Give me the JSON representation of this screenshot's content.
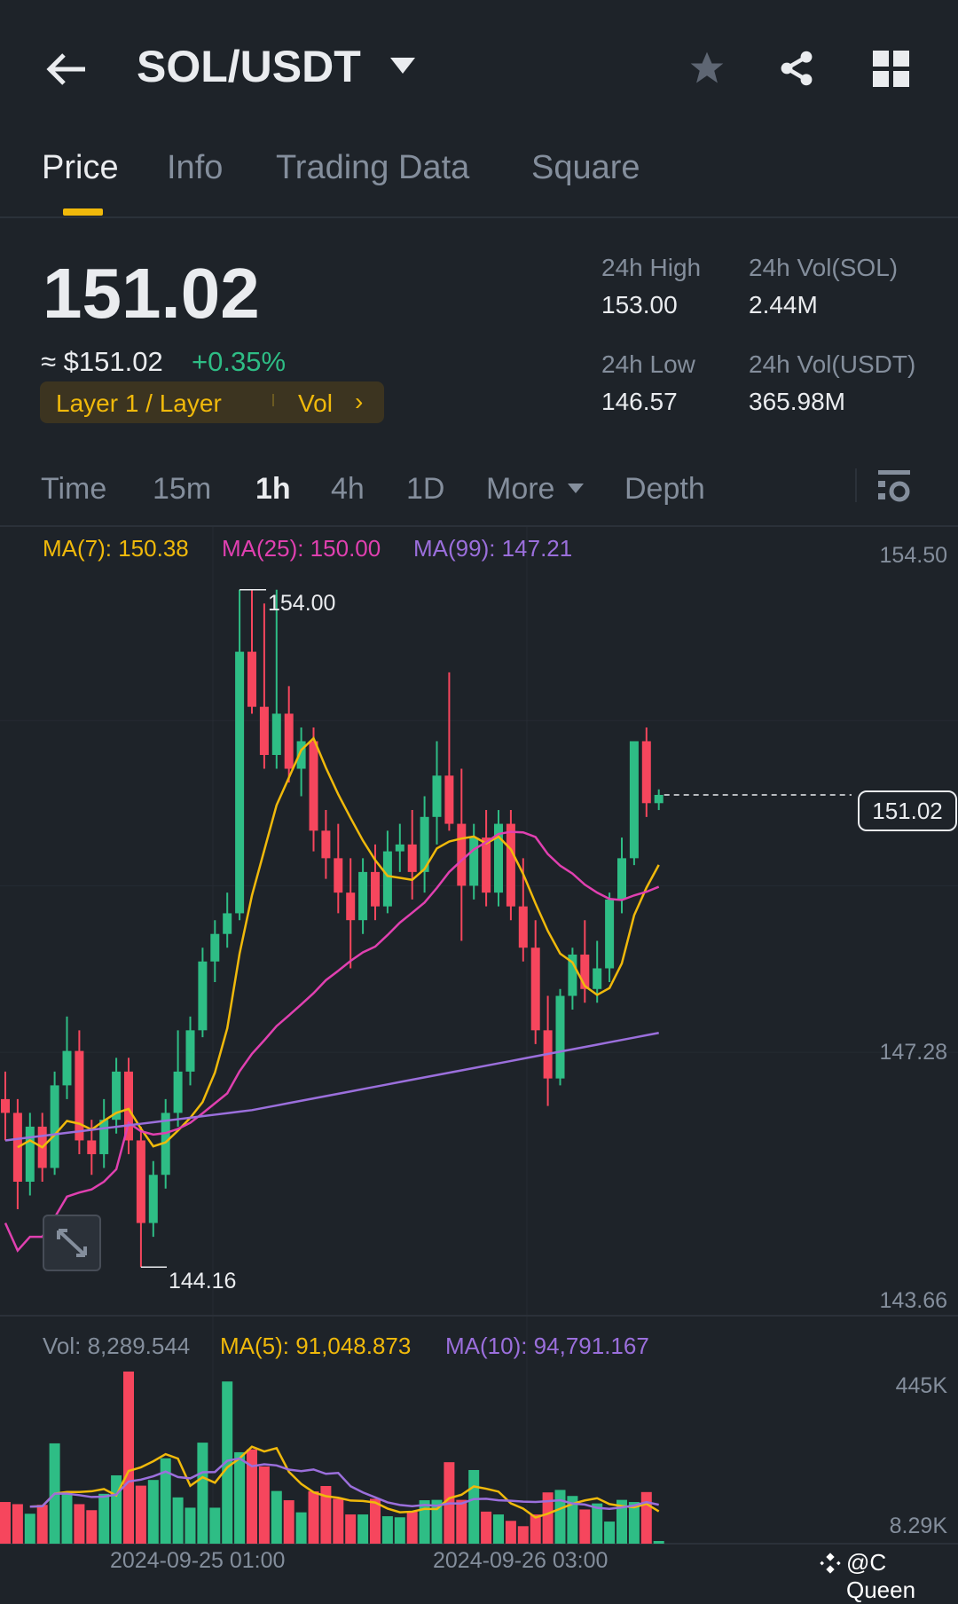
{
  "header": {
    "title": "SOL/USDT",
    "back_icon": "arrow-left",
    "dropdown_icon": "caret-down",
    "star_icon": "star",
    "share_icon": "share",
    "grid_icon": "grid"
  },
  "tabs": [
    {
      "label": "Price"
    },
    {
      "label": "Info"
    },
    {
      "label": "Trading Data"
    },
    {
      "label": "Square"
    }
  ],
  "price": {
    "last": "151.02",
    "usd": "≈ $151.02",
    "change": "+0.35%",
    "tag": "Layer 1 / Layer",
    "tag_vol": "Vol"
  },
  "stats": {
    "high_label": "24h High",
    "high": "153.00",
    "low_label": "24h Low",
    "low": "146.57",
    "vol_sol_label": "24h Vol(SOL)",
    "vol_sol": "2.44M",
    "vol_usdt_label": "24h Vol(USDT)",
    "vol_usdt": "365.98M"
  },
  "intervals": [
    "Time",
    "15m",
    "1h",
    "4h",
    "1D",
    "More",
    "Depth"
  ],
  "colors": {
    "up": "#2ebd85",
    "down": "#f6465d",
    "ma7": "#f0b90b",
    "ma25": "#e040b0",
    "ma99": "#9b6fdc"
  },
  "chart_data": {
    "type": "candlestick",
    "ma_legend": {
      "ma7": "MA(7): 150.38",
      "ma25": "MA(25): 150.00",
      "ma99": "MA(99): 147.21"
    },
    "y_ticks": [
      "154.50",
      "147.28",
      "143.66"
    ],
    "ylim": [
      143.66,
      154.5
    ],
    "current_price": "151.02",
    "max_label": "154.00",
    "min_label": "144.16",
    "ohlc": [
      [
        146.6,
        147.0,
        146.0,
        146.4
      ],
      [
        146.4,
        146.6,
        145.0,
        145.4
      ],
      [
        145.4,
        146.4,
        145.2,
        146.2
      ],
      [
        146.2,
        146.4,
        145.4,
        145.6
      ],
      [
        145.6,
        147.0,
        145.5,
        146.8
      ],
      [
        146.8,
        147.8,
        146.6,
        147.3
      ],
      [
        147.3,
        147.6,
        145.8,
        146.0
      ],
      [
        146.0,
        146.3,
        145.5,
        145.8
      ],
      [
        145.8,
        146.6,
        145.6,
        146.3
      ],
      [
        146.3,
        147.2,
        146.1,
        147.0
      ],
      [
        147.0,
        147.2,
        145.8,
        146.0
      ],
      [
        146.0,
        146.2,
        144.16,
        144.8
      ],
      [
        144.8,
        145.7,
        144.6,
        145.5
      ],
      [
        145.5,
        146.6,
        145.3,
        146.4
      ],
      [
        146.4,
        147.6,
        146.2,
        147.0
      ],
      [
        147.0,
        147.8,
        146.8,
        147.6
      ],
      [
        147.6,
        148.8,
        147.5,
        148.6
      ],
      [
        148.6,
        149.2,
        148.3,
        149.0
      ],
      [
        149.0,
        149.6,
        148.8,
        149.3
      ],
      [
        149.3,
        154.0,
        149.2,
        153.1
      ],
      [
        153.1,
        154.0,
        152.2,
        152.3
      ],
      [
        152.3,
        153.8,
        151.4,
        151.6
      ],
      [
        151.6,
        154.0,
        151.4,
        152.2
      ],
      [
        152.2,
        152.6,
        151.2,
        151.4
      ],
      [
        151.4,
        152.0,
        151.0,
        151.8
      ],
      [
        151.8,
        152.0,
        150.2,
        150.5
      ],
      [
        150.5,
        150.8,
        149.8,
        150.1
      ],
      [
        150.1,
        150.6,
        149.3,
        149.6
      ],
      [
        149.6,
        150.1,
        148.5,
        149.2
      ],
      [
        149.2,
        150.1,
        149.0,
        149.9
      ],
      [
        149.9,
        150.3,
        149.2,
        149.4
      ],
      [
        149.4,
        150.5,
        149.3,
        150.2
      ],
      [
        150.2,
        150.6,
        149.9,
        150.3
      ],
      [
        150.3,
        150.8,
        149.5,
        149.9
      ],
      [
        149.9,
        151.0,
        149.6,
        150.7
      ],
      [
        150.7,
        151.8,
        150.3,
        151.3
      ],
      [
        151.3,
        152.8,
        150.5,
        150.6
      ],
      [
        150.6,
        151.4,
        148.9,
        149.7
      ],
      [
        149.7,
        150.6,
        149.5,
        150.4
      ],
      [
        150.4,
        150.8,
        149.4,
        149.6
      ],
      [
        149.6,
        150.8,
        149.4,
        150.6
      ],
      [
        150.6,
        150.8,
        149.2,
        149.4
      ],
      [
        149.4,
        150.1,
        148.6,
        148.8
      ],
      [
        148.8,
        149.2,
        147.4,
        147.6
      ],
      [
        147.6,
        148.1,
        146.5,
        146.9
      ],
      [
        146.9,
        148.2,
        146.8,
        148.1
      ],
      [
        148.1,
        148.8,
        147.9,
        148.7
      ],
      [
        148.7,
        149.2,
        148.0,
        148.2
      ],
      [
        148.2,
        148.9,
        148.0,
        148.5
      ],
      [
        148.5,
        149.6,
        148.3,
        149.5
      ],
      [
        149.5,
        150.4,
        149.3,
        150.1
      ],
      [
        150.1,
        151.8,
        150.0,
        151.8
      ],
      [
        151.8,
        152.0,
        150.7,
        150.9
      ],
      [
        150.9,
        151.1,
        150.8,
        151.02
      ]
    ],
    "volume": {
      "legend_vol": "Vol: 8,289.544",
      "legend_ma5": "MA(5): 91,048.873",
      "legend_ma10": "MA(10): 94,791.167",
      "y_ticks": [
        "445K",
        "8.29K"
      ],
      "values_k": [
        118,
        112,
        85,
        110,
        283,
        141,
        112,
        95,
        141,
        193,
        485,
        164,
        180,
        241,
        131,
        102,
        285,
        102,
        457,
        258,
        266,
        218,
        149,
        123,
        89,
        148,
        163,
        127,
        83,
        83,
        127,
        78,
        75,
        91,
        123,
        124,
        230,
        124,
        208,
        91,
        83,
        65,
        50,
        83,
        145,
        152,
        135,
        97,
        114,
        63,
        124,
        118,
        146,
        8.29
      ]
    },
    "x_ticks": [
      "2024-09-25 01:00",
      "2024-09-26 03:00"
    ]
  },
  "watermark": "@C Queen"
}
